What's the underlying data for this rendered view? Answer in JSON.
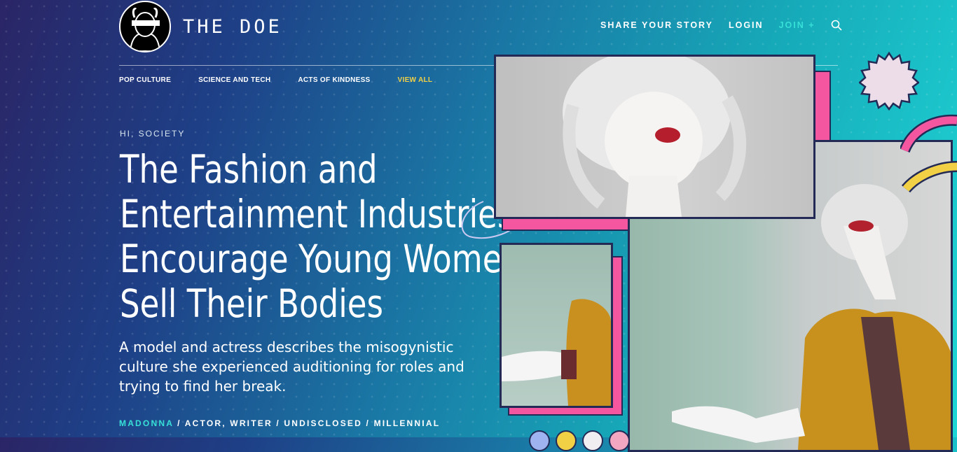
{
  "brand": {
    "name": "THE DOE"
  },
  "topnav": {
    "share": "SHARE YOUR STORY",
    "login": "LOGIN",
    "join": "JOIN +"
  },
  "catnav": [
    "POP CULTURE",
    "SCIENCE AND TECH",
    "ACTS OF KINDNESS",
    "VIEW ALL"
  ],
  "article": {
    "eyebrow": "HI, SOCIETY",
    "headline_lines": [
      "The Fashion and",
      "Entertainment Industries",
      "Encourage Young Women to",
      "Sell Their Bodies"
    ],
    "dek": "A model and actress describes the misogynistic culture she experienced auditioning for roles and trying to find her break.",
    "byline_name": "MADONNA",
    "byline_rest": " / ACTOR, WRITER / UNDISCLOSED / MILLENNIAL"
  },
  "colors": {
    "accent_teal": "#36e0d7",
    "accent_yellow": "#f2d046",
    "accent_pink": "#f456a0"
  },
  "icons": {
    "search": "search-icon",
    "logo": "logo-icon"
  }
}
